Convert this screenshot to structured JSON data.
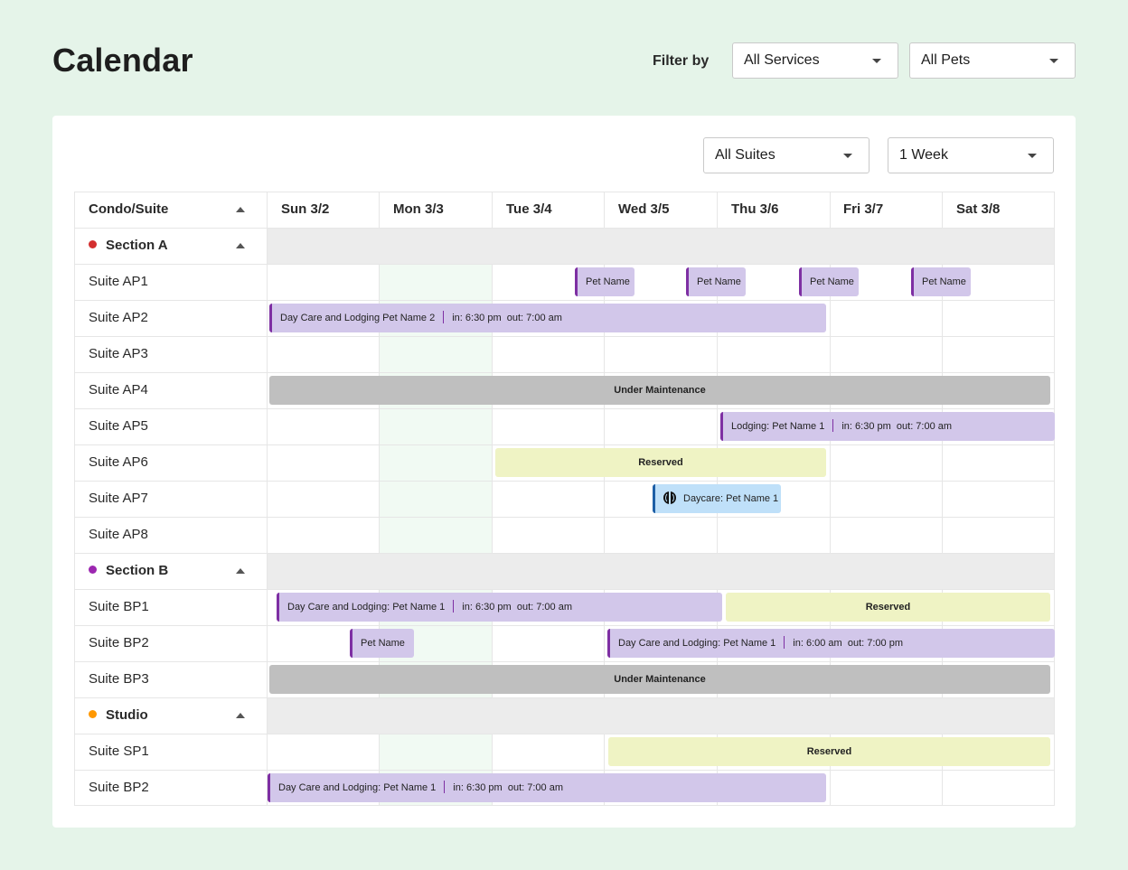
{
  "header": {
    "title": "Calendar",
    "filter_label": "Filter by",
    "services_select": "All Services",
    "pets_select": "All Pets"
  },
  "toolbar": {
    "suites_select": "All Suites",
    "range_select": "1 Week"
  },
  "columns": {
    "first": "Condo/Suite",
    "days": [
      "Sun 3/2",
      "Mon 3/3",
      "Tue 3/4",
      "Wed 3/5",
      "Thu 3/6",
      "Fri 3/7",
      "Sat 3/8"
    ]
  },
  "sections": [
    {
      "name": "Section A",
      "color": "#d32f2f",
      "suites": [
        "Suite AP1",
        "Suite AP2",
        "Suite AP3",
        "Suite AP4",
        "Suite AP5",
        "Suite AP6",
        "Suite AP7",
        "Suite AP8"
      ]
    },
    {
      "name": "Section B",
      "color": "#9c27b0",
      "suites": [
        "Suite BP1",
        "Suite BP2",
        "Suite BP3"
      ]
    },
    {
      "name": "Studio",
      "color": "#ff9800",
      "suites": [
        "Suite SP1",
        "Suite BP2"
      ]
    }
  ],
  "colors": {
    "booking": "#d2c7ea",
    "booking_accent": "#7e2fa3",
    "maintenance": "#bfbfbf",
    "reserved": "#eff3c4",
    "daycare": "#bfe0f9",
    "daycare_accent": "#1d5fa6"
  },
  "events": [
    {
      "suite": "Suite AP1",
      "type": "booking",
      "label": "Pet Name"
    },
    {
      "suite": "Suite AP1",
      "type": "booking",
      "label": "Pet Name"
    },
    {
      "suite": "Suite AP1",
      "type": "booking",
      "label": "Pet Name"
    },
    {
      "suite": "Suite AP1",
      "type": "booking",
      "label": "Pet Name"
    },
    {
      "suite": "Suite AP2",
      "type": "booking",
      "label": "Day Care and Lodging Pet Name 2",
      "in": "in: 6:30 pm",
      "out": "out:  7:00 am"
    },
    {
      "suite": "Suite AP4",
      "type": "maintenance",
      "label": "Under Maintenance"
    },
    {
      "suite": "Suite AP5",
      "type": "booking",
      "label": "Lodging: Pet Name 1",
      "in": "in: 6:30 pm",
      "out": "out:  7:00 am"
    },
    {
      "suite": "Suite AP6",
      "type": "reserved",
      "label": "Reserved"
    },
    {
      "suite": "Suite AP7",
      "type": "daycare",
      "label": "Daycare: Pet Name 1",
      "icon": "ball-icon"
    },
    {
      "suite": "Suite BP1",
      "type": "booking",
      "label": "Day Care and Lodging: Pet Name 1",
      "in": "in: 6:30 pm",
      "out": "out:  7:00 am"
    },
    {
      "suite": "Suite BP1",
      "type": "reserved",
      "label": "Reserved"
    },
    {
      "suite": "Suite BP2",
      "type": "booking",
      "label": "Pet Name"
    },
    {
      "suite": "Suite BP2",
      "type": "booking",
      "label": "Day Care and Lodging: Pet Name 1",
      "in": "in: 6:00 am",
      "out": "out:  7:00 pm"
    },
    {
      "suite": "Suite BP3",
      "type": "maintenance",
      "label": "Under Maintenance"
    },
    {
      "suite": "Suite SP1",
      "type": "reserved",
      "label": "Reserved"
    },
    {
      "suite": "Suite BP2",
      "type": "booking",
      "label": "Day Care and Lodging: Pet Name 1",
      "in": "in: 6:30 pm",
      "out": "out:  7:00 am"
    }
  ]
}
